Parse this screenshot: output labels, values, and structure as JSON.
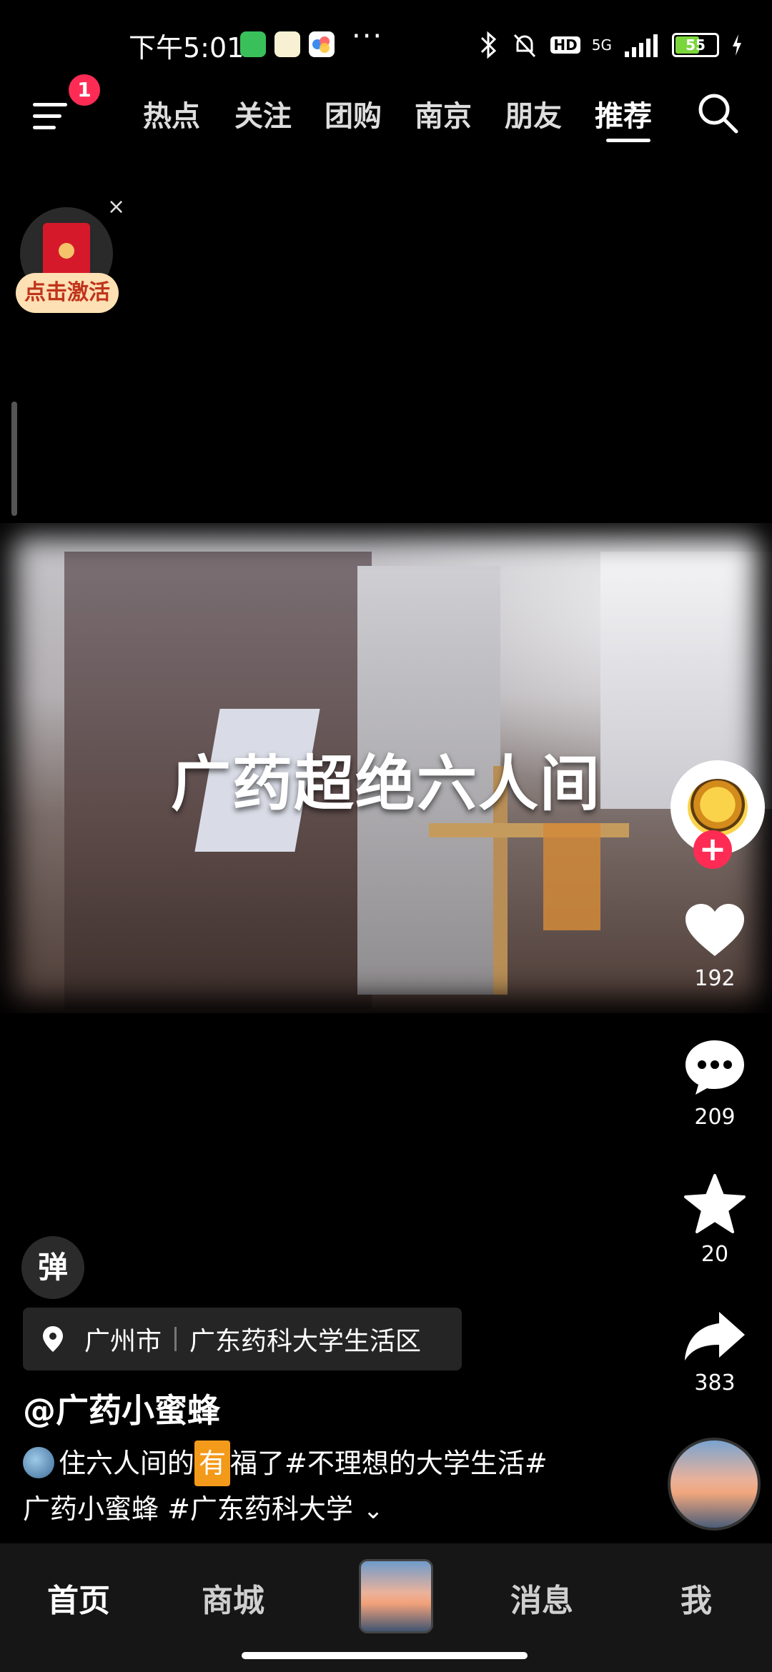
{
  "status_bar": {
    "time": "下午5:01",
    "app_icons": [
      "wechat-mini-icon",
      "58-app-icon",
      "cloud-app-icon"
    ],
    "more": "···",
    "network": "5G",
    "hd": "HD",
    "battery": "55"
  },
  "top_nav": {
    "menu_badge": "1",
    "tabs": [
      {
        "label": "热点"
      },
      {
        "label": "关注"
      },
      {
        "label": "团购"
      },
      {
        "label": "南京"
      },
      {
        "label": "朋友"
      },
      {
        "label": "推荐",
        "active": true
      }
    ]
  },
  "promo": {
    "label": "点击激活",
    "close": "×"
  },
  "video": {
    "caption": "广药超绝六人间"
  },
  "actions": {
    "like_count": "192",
    "comment_count": "209",
    "favorite_count": "20",
    "share_count": "383",
    "follow_symbol": "+"
  },
  "post": {
    "danmu_label": "弹",
    "location_city": "广州市",
    "location_place": "广东药科大学生活区",
    "author": "@广药小蜜蜂",
    "desc_part1": "住六人间的",
    "desc_highlight": "有",
    "desc_part2": "福了#不理想的大学生活#",
    "desc_line2": "广药小蜜蜂  #广东药科大学",
    "expand": "⌄"
  },
  "bottom_nav": {
    "home": "首页",
    "mall": "商城",
    "messages": "消息",
    "me": "我"
  },
  "colors": {
    "accent": "#fe2c55",
    "background": "#000000",
    "nav_bg": "#161616"
  }
}
